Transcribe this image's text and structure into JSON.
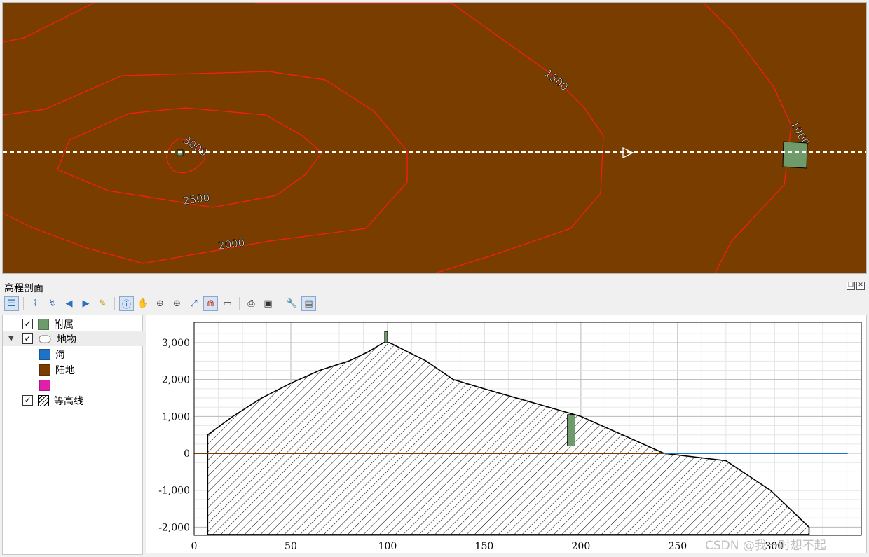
{
  "map": {
    "colors": {
      "land": "#7a3d00",
      "contour": "#ff1a1a",
      "outbuilding": "#6f9a6a",
      "profile_line": "#ffffff"
    },
    "contour_labels": [
      "3000",
      "2500",
      "2000",
      "1500",
      "1000"
    ],
    "direction_marker": "triangle-arrow-icon"
  },
  "panel": {
    "title": "高程剖面",
    "controls": [
      "restore-icon",
      "close-icon"
    ]
  },
  "toolbar": {
    "icons": [
      "layer-tree-icon",
      "capture-line-icon",
      "capture-curve-icon",
      "nudge-left-icon",
      "nudge-right-icon",
      "clear-icon",
      "identify-icon",
      "pan-icon",
      "zoom-x-icon",
      "zoom-in-icon",
      "zoom-full-icon",
      "snap-icon",
      "measure-icon",
      "export-pdf-icon",
      "export-image-icon",
      "settings-icon",
      "options-icon"
    ]
  },
  "layer_tree": [
    {
      "label": "附属",
      "checked": true,
      "swatch": "#6f9a6a",
      "kind": "layer"
    },
    {
      "label": "地物",
      "checked": true,
      "kind": "group",
      "expanded": true
    },
    {
      "label": "海",
      "swatch": "#1f73c6",
      "kind": "class"
    },
    {
      "label": "陆地",
      "swatch": "#7a3d00",
      "kind": "class"
    },
    {
      "label": "",
      "swatch": "#e020a8",
      "kind": "class"
    },
    {
      "label": "等高线",
      "checked": true,
      "kind": "layer",
      "swatch": "hatch"
    }
  ],
  "chart_data": {
    "type": "area",
    "x_ticks": [
      0,
      50,
      100,
      150,
      200,
      250,
      300
    ],
    "y_ticks": [
      -2000,
      -1000,
      0,
      1000,
      2000,
      3000
    ],
    "x_tick_labels": [
      "0",
      "50",
      "100",
      "150",
      "200",
      "250",
      "300"
    ],
    "y_tick_labels": [
      "-2,000",
      "-1,000",
      "0",
      "1,000",
      "2,000",
      "3,000"
    ],
    "xlim": [
      0,
      345
    ],
    "ylim": [
      -2220,
      3550
    ],
    "grid": true,
    "series": [
      {
        "style": "hatch",
        "color": "#000000",
        "x": [
          7,
          7,
          20,
          35,
          50,
          65,
          80,
          90,
          98,
          101,
          120,
          134,
          150,
          200,
          243,
          275,
          298,
          318,
          318
        ],
        "y": [
          -2200,
          500,
          1000,
          1500,
          1900,
          2250,
          2500,
          2750,
          3000,
          3000,
          2500,
          2000,
          1750,
          1000,
          0,
          -200,
          -1000,
          -2000,
          -2200
        ]
      },
      {
        "style": "line",
        "color": "#1f73c6",
        "x": [
          243,
          338
        ],
        "y": [
          0,
          0
        ]
      },
      {
        "style": "line",
        "color": "#7a3d00",
        "x": [
          0,
          243
        ],
        "y": [
          0,
          0
        ]
      }
    ],
    "bars": [
      {
        "color": "#6f9a6a",
        "x": [
          98.5,
          100
        ],
        "y": [
          3000,
          3300
        ]
      },
      {
        "color": "#6f9a6a",
        "x": [
          193,
          197
        ],
        "y": [
          200,
          1050
        ]
      }
    ]
  },
  "watermark": "CSDN @我一时想不起"
}
